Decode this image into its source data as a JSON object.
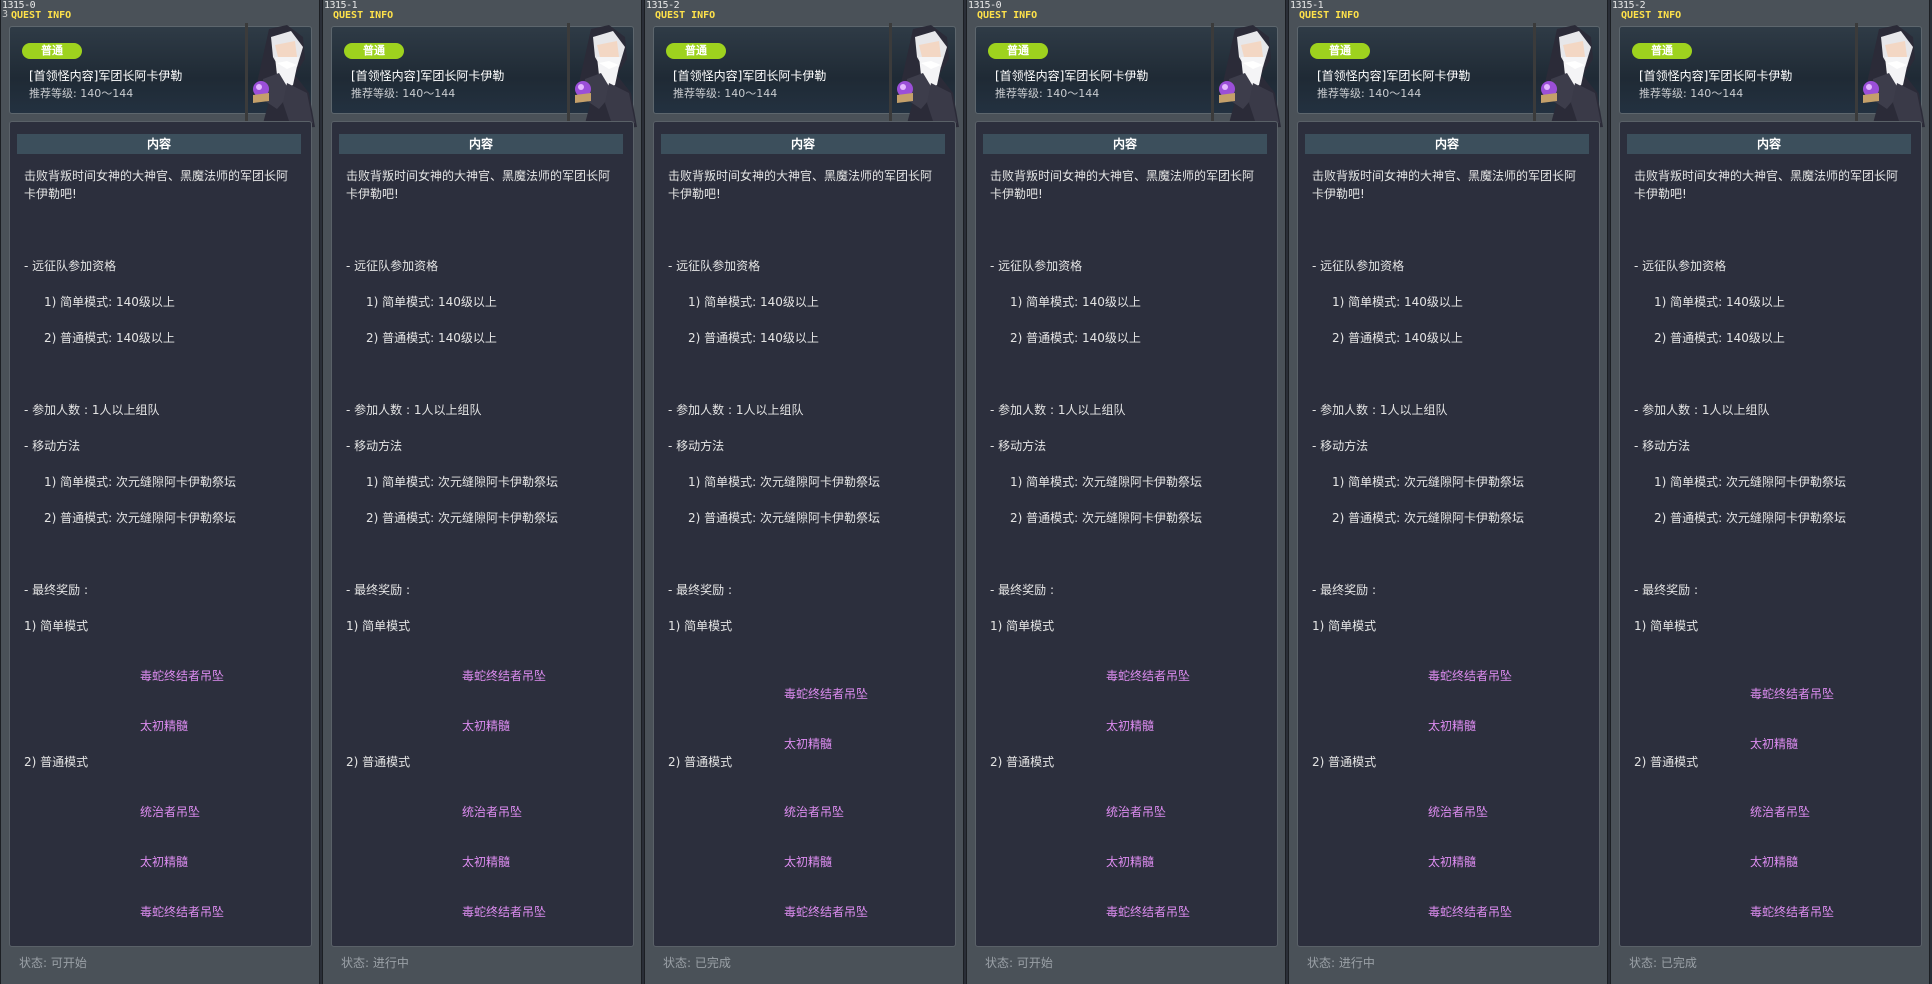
{
  "panels": [
    {
      "id": "1315-0",
      "overlay": "3",
      "quest_info": "QUEST INFO",
      "badge": "普通",
      "title": "[首领怪内容]军团长阿卡伊勒",
      "level": "推荐等级: 140〜144",
      "content_title": "内容",
      "desc1": "击败背叛时间女神的大神官、黑魔法师的军团长阿",
      "desc2": "卡伊勒吧!",
      "sec_eligibility": "- 远征队参加资格",
      "elig_easy": "1) 简单模式:  140级以上",
      "elig_normal": "2) 普通模式:  140级以上",
      "sec_party": "- 参加人数  :  1人以上组队",
      "sec_move": "- 移动方法",
      "move_easy": "1) 简单模式:  次元缝隙阿卡伊勒祭坛",
      "move_normal": "2) 普通模式:  次元缝隙阿卡伊勒祭坛",
      "sec_reward": "- 最终奖励  :",
      "reward_easy_label": "1) 简单模式",
      "reward_normal_label": "2) 普通模式",
      "easy_rewards": [
        "毒蛇终结者吊坠",
        "太初精髓"
      ],
      "normal_rewards": [
        "统治者吊坠",
        "太初精髓",
        "毒蛇终结者吊坠"
      ],
      "status": "状态:  可开始"
    },
    {
      "id": "1315-1",
      "overlay": "",
      "quest_info": "QUEST INFO",
      "badge": "普通",
      "title": "[首领怪内容]军团长阿卡伊勒",
      "level": "推荐等级: 140〜144",
      "content_title": "内容",
      "desc1": "击败背叛时间女神的大神官、黑魔法师的军团长阿",
      "desc2": "卡伊勒吧!",
      "sec_eligibility": "- 远征队参加资格",
      "elig_easy": "1) 简单模式:  140级以上",
      "elig_normal": "2) 普通模式:  140级以上",
      "sec_party": "- 参加人数  :  1人以上组队",
      "sec_move": "- 移动方法",
      "move_easy": "1) 简单模式:  次元缝隙阿卡伊勒祭坛",
      "move_normal": "2) 普通模式:  次元缝隙阿卡伊勒祭坛",
      "sec_reward": "- 最终奖励  :",
      "reward_easy_label": "1) 简单模式",
      "reward_normal_label": "2) 普通模式",
      "easy_rewards": [
        "毒蛇终结者吊坠",
        "太初精髓"
      ],
      "normal_rewards": [
        "统治者吊坠",
        "太初精髓",
        "毒蛇终结者吊坠"
      ],
      "status": "状态:  进行中"
    },
    {
      "id": "1315-2",
      "overlay": "",
      "quest_info": "QUEST INFO",
      "badge": "普通",
      "title": "[首领怪内容]军团长阿卡伊勒",
      "level": "推荐等级: 140〜144",
      "content_title": "内容",
      "desc1": "击败背叛时间女神的大神官、黑魔法师的军团长阿",
      "desc2": "卡伊勒吧!",
      "sec_eligibility": "- 远征队参加资格",
      "elig_easy": "1) 简单模式:  140级以上",
      "elig_normal": "2) 普通模式:  140级以上",
      "sec_party": "- 参加人数  :  1人以上组队",
      "sec_move": "- 移动方法",
      "move_easy": "1) 简单模式:  次元缝隙阿卡伊勒祭坛",
      "move_normal": "2) 普通模式:  次元缝隙阿卡伊勒祭坛",
      "sec_reward": "- 最终奖励  :",
      "reward_easy_label": "1) 简单模式",
      "reward_normal_label": "2) 普通模式",
      "easy_rewards": [
        "毒蛇终结者吊坠",
        "太初精髓"
      ],
      "normal_rewards": [
        "统治者吊坠",
        "太初精髓",
        "毒蛇终结者吊坠"
      ],
      "status": "状态:  已完成"
    },
    {
      "id": "1315-0",
      "overlay": "",
      "quest_info": "QUEST INFO",
      "badge": "普通",
      "title": "[首领怪内容]军团长阿卡伊勒",
      "level": "推荐等级: 140〜144",
      "content_title": "内容",
      "desc1": "击败背叛时间女神的大神官、黑魔法师的军团长阿",
      "desc2": "卡伊勒吧!",
      "sec_eligibility": "- 远征队参加资格",
      "elig_easy": "1) 简单模式:  140级以上",
      "elig_normal": "2) 普通模式:  140级以上",
      "sec_party": "- 参加人数  :  1人以上组队",
      "sec_move": "- 移动方法",
      "move_easy": "1) 简单模式:  次元缝隙阿卡伊勒祭坛",
      "move_normal": "2) 普通模式:  次元缝隙阿卡伊勒祭坛",
      "sec_reward": "- 最终奖励  :",
      "reward_easy_label": "1) 简单模式",
      "reward_normal_label": "2) 普通模式",
      "easy_rewards": [
        "毒蛇终结者吊坠",
        "太初精髓"
      ],
      "normal_rewards": [
        "统治者吊坠",
        "太初精髓",
        "毒蛇终结者吊坠"
      ],
      "status": "状态:  可开始"
    },
    {
      "id": "1315-1",
      "overlay": "",
      "quest_info": "QUEST INFO",
      "badge": "普通",
      "title": "[首领怪内容]军团长阿卡伊勒",
      "level": "推荐等级: 140〜144",
      "content_title": "内容",
      "desc1": "击败背叛时间女神的大神官、黑魔法师的军团长阿",
      "desc2": "卡伊勒吧!",
      "sec_eligibility": "- 远征队参加资格",
      "elig_easy": "1) 简单模式:  140级以上",
      "elig_normal": "2) 普通模式:  140级以上",
      "sec_party": "- 参加人数  :  1人以上组队",
      "sec_move": "- 移动方法",
      "move_easy": "1) 简单模式:  次元缝隙阿卡伊勒祭坛",
      "move_normal": "2) 普通模式:  次元缝隙阿卡伊勒祭坛",
      "sec_reward": "- 最终奖励  :",
      "reward_easy_label": "1) 简单模式",
      "reward_normal_label": "2) 普通模式",
      "easy_rewards": [
        "毒蛇终结者吊坠",
        "太初精髓"
      ],
      "normal_rewards": [
        "统治者吊坠",
        "太初精髓",
        "毒蛇终结者吊坠"
      ],
      "status": "状态:  进行中"
    },
    {
      "id": "1315-2",
      "overlay": "",
      "quest_info": "QUEST INFO",
      "badge": "普通",
      "title": "[首领怪内容]军团长阿卡伊勒",
      "level": "推荐等级: 140〜144",
      "content_title": "内容",
      "desc1": "击败背叛时间女神的大神官、黑魔法师的军团长阿",
      "desc2": "卡伊勒吧!",
      "sec_eligibility": "- 远征队参加资格",
      "elig_easy": "1) 简单模式:  140级以上",
      "elig_normal": "2) 普通模式:  140级以上",
      "sec_party": "- 参加人数  :  1人以上组队",
      "sec_move": "- 移动方法",
      "move_easy": "1) 简单模式:  次元缝隙阿卡伊勒祭坛",
      "move_normal": "2) 普通模式:  次元缝隙阿卡伊勒祭坛",
      "sec_reward": "- 最终奖励  :",
      "reward_easy_label": "1) 简单模式",
      "reward_normal_label": "2) 普通模式",
      "easy_rewards": [
        "毒蛇终结者吊坠",
        "太初精髓"
      ],
      "normal_rewards": [
        "统治者吊坠",
        "太初精髓",
        "毒蛇终结者吊坠"
      ],
      "status": "状态:  已完成"
    }
  ],
  "colors": {
    "badge": "#9ed21e",
    "quest_info": "#ffe24a",
    "reward": "#dd8cf0"
  },
  "icons": {
    "npc_portrait": "arkarium-npc-portrait-icon"
  }
}
